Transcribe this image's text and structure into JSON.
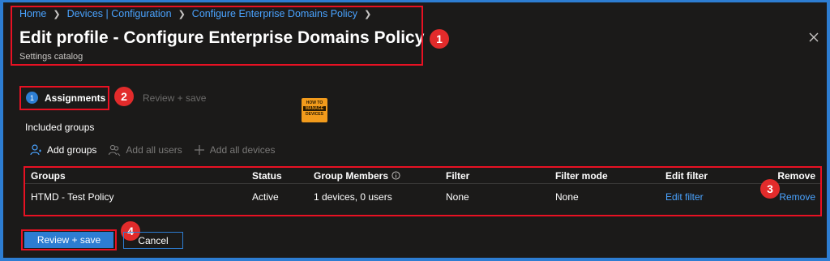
{
  "breadcrumb": {
    "items": [
      "Home",
      "Devices | Configuration",
      "Configure Enterprise Domains Policy"
    ]
  },
  "header": {
    "title": "Edit profile - Configure Enterprise Domains Policy",
    "subtitle": "Settings catalog"
  },
  "wizard": {
    "step_number": "1",
    "active_step": "Assignments",
    "next_step": "Review + save"
  },
  "logo": {
    "line1": "HOW TO",
    "line2": "MANAGE",
    "line3": "DEVICES"
  },
  "section": {
    "included_groups": "Included groups"
  },
  "toolbar": {
    "add_groups": "Add groups",
    "add_all_users": "Add all users",
    "add_all_devices": "Add all devices"
  },
  "table": {
    "headers": {
      "groups": "Groups",
      "status": "Status",
      "group_members": "Group Members",
      "filter": "Filter",
      "filter_mode": "Filter mode",
      "edit_filter": "Edit filter",
      "remove": "Remove"
    },
    "rows": [
      {
        "group": "HTMD - Test Policy",
        "status": "Active",
        "members": "1 devices, 0 users",
        "filter": "None",
        "filter_mode": "None",
        "edit_filter": "Edit filter",
        "remove": "Remove"
      }
    ]
  },
  "footer": {
    "review_save": "Review + save",
    "cancel": "Cancel"
  },
  "callouts": [
    "1",
    "2",
    "3",
    "4"
  ],
  "colors": {
    "accent": "#2d7dd2",
    "highlight": "#e81123",
    "link": "#4aa3ff",
    "background": "#1b1a19"
  },
  "icons": [
    "chevron-right-icon",
    "close-icon",
    "add-person-icon",
    "add-users-icon",
    "plus-icon",
    "info-icon"
  ]
}
